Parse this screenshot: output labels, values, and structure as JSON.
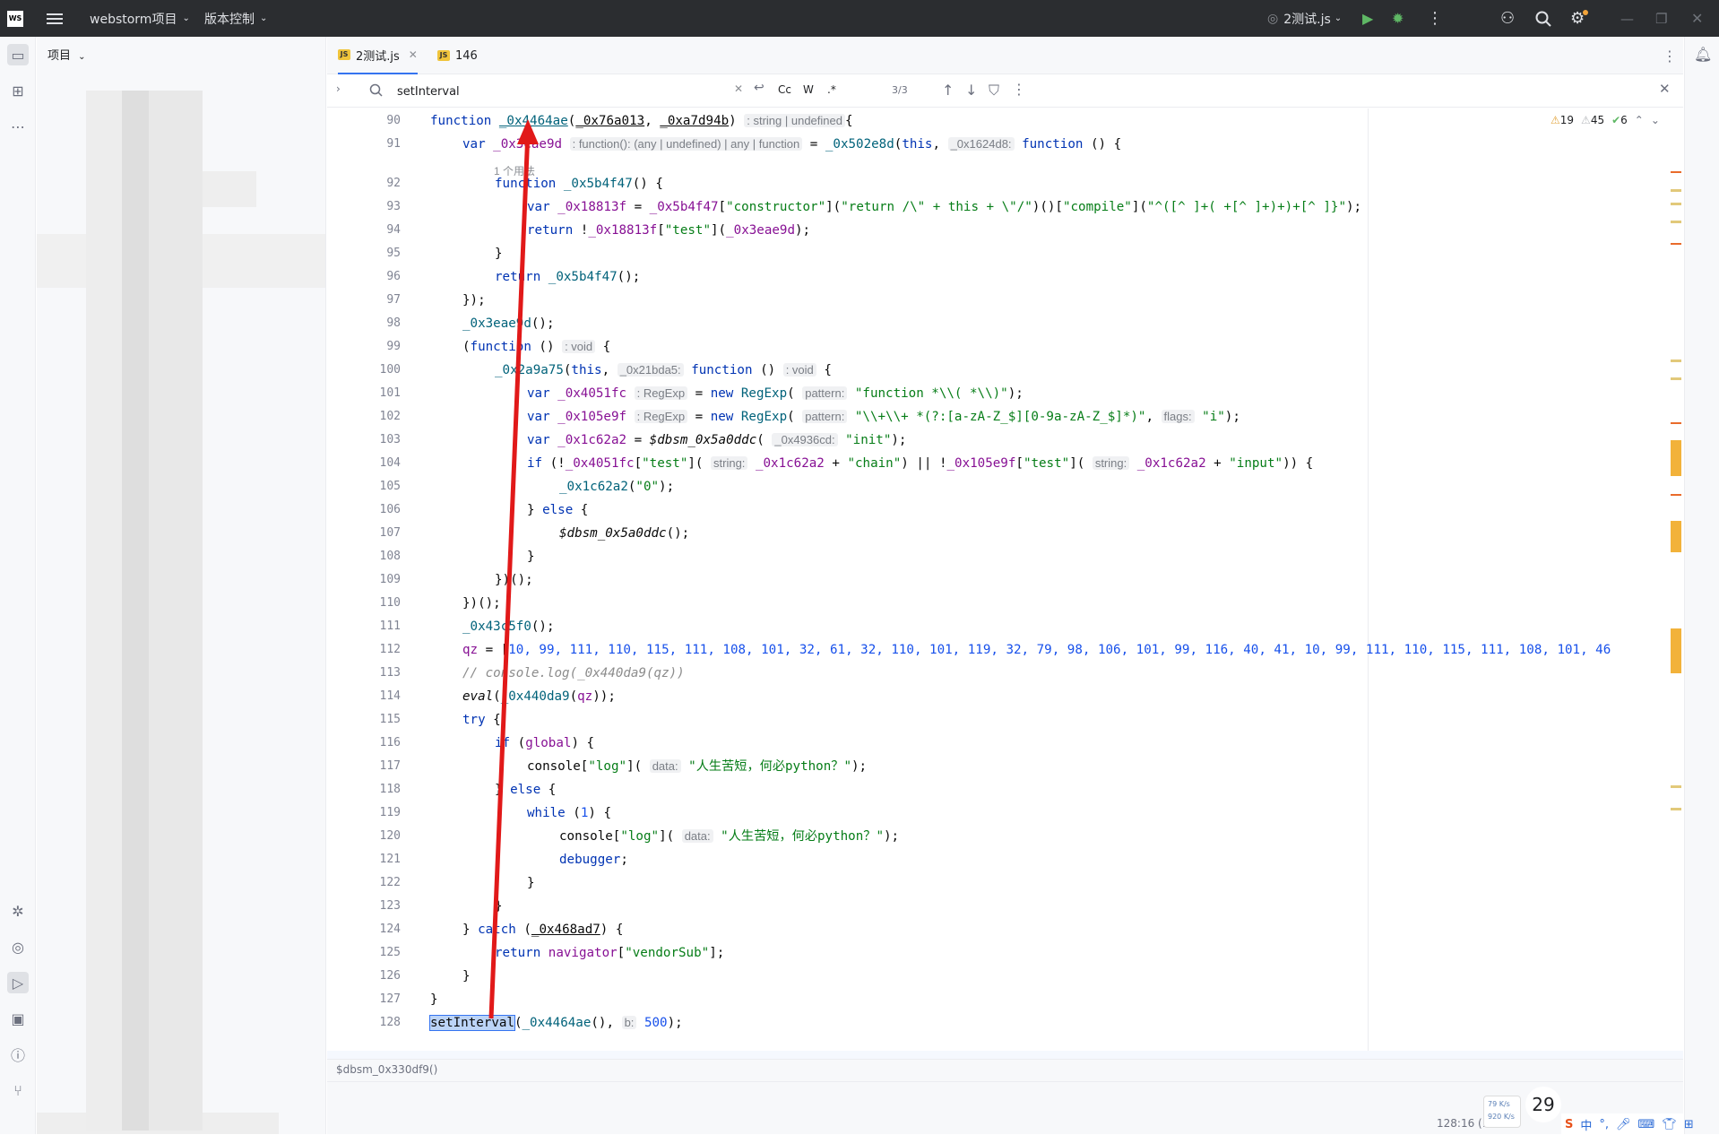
{
  "titlebar": {
    "logo": "WS",
    "project": "webstorm项目",
    "vcs": "版本控制",
    "run_config": "2测试.js"
  },
  "sidebar": {
    "title": "项目"
  },
  "tabs": [
    {
      "label": "2测试.js"
    },
    {
      "label": "146"
    }
  ],
  "find": {
    "query": "setInterval",
    "count": "3/3",
    "opt_case": "Cc",
    "opt_word": "W",
    "opt_regex": ".*"
  },
  "inspections": {
    "warnings1": "19",
    "warnings2": "45",
    "ok": "6"
  },
  "code_lines": [
    {
      "n": "90",
      "indent": 0,
      "html": "<span class='k'>function</span> <span class='f' style='text-decoration:underline'>_0x4464ae</span>(<span style='text-decoration:underline'>_0x76a013</span>, <span style='text-decoration:underline'>_0xa7d94b</span>) <span class='h'>: string | undefined</span>{"
    },
    {
      "n": "91",
      "indent": 1,
      "html": "<span class='k'>var</span> <span class='v'>_0x3eae9d</span> <span class='h'>: function(): (any | undefined) | any | function</span> = <span class='f'>_0x502e8d</span>(<span class='k'>this</span>, <span class='h'>_0x1624d8:</span> <span class='k'>function</span> () {"
    },
    {
      "n": "92",
      "indent": 2,
      "html": "<span class='k'>function</span> <span class='f'>_0x5b4f47</span>() {"
    },
    {
      "n": "93",
      "indent": 3,
      "html": "<span class='k'>var</span> <span class='v'>_0x18813f</span> = <span class='v'>_0x5b4f47</span>[<span class='s'>\"constructor\"</span>](<span class='s'>\"return /\\\" + this + \\\"/\"</span>)()[<span class='s'>\"compile\"</span>](<span class='s'>\"^([^ ]+( +[^ ]+)+)+[^ ]}\"</span>);"
    },
    {
      "n": "94",
      "indent": 3,
      "html": "<span class='k'>return</span> !<span class='v'>_0x18813f</span>[<span class='s'>\"test\"</span>](<span class='v'>_0x3eae9d</span>);"
    },
    {
      "n": "95",
      "indent": 2,
      "html": "}"
    },
    {
      "n": "96",
      "indent": 2,
      "html": "<span class='k'>return</span> <span class='f'>_0x5b4f47</span>();"
    },
    {
      "n": "97",
      "indent": 1,
      "html": "});"
    },
    {
      "n": "98",
      "indent": 1,
      "html": "<span class='f'>_0x3eae9d</span>();"
    },
    {
      "n": "99",
      "indent": 1,
      "html": "(<span class='k'>function</span> () <span class='h'>: void</span> {"
    },
    {
      "n": "100",
      "indent": 2,
      "html": "<span class='f'>_0x2a9a75</span>(<span class='k'>this</span>, <span class='h'>_0x21bda5:</span> <span class='k'>function</span> () <span class='h'>: void</span> {"
    },
    {
      "n": "101",
      "indent": 3,
      "html": "<span class='k'>var</span> <span class='v'>_0x4051fc</span> <span class='h'>: RegExp</span> = <span class='k'>new</span> <span class='f'>RegExp</span>( <span class='h'>pattern:</span> <span class='s'>\"function *\\\\( *\\\\)\"</span>);"
    },
    {
      "n": "102",
      "indent": 3,
      "html": "<span class='k'>var</span> <span class='v'>_0x105e9f</span> <span class='h'>: RegExp</span> = <span class='k'>new</span> <span class='f'>RegExp</span>( <span class='h'>pattern:</span> <span class='s'>\"\\\\+\\\\+ *(?:[a-zA-Z_$][0-9a-zA-Z_$]*)\"</span>, <span class='h'>flags:</span> <span class='s'>\"i\"</span>);"
    },
    {
      "n": "103",
      "indent": 3,
      "html": "<span class='k'>var</span> <span class='v'>_0x1c62a2</span> = <span class='it'>$dbsm_0x5a0ddc</span>( <span class='h'>_0x4936cd:</span> <span class='s'>\"init\"</span>);"
    },
    {
      "n": "104",
      "indent": 3,
      "html": "<span class='k'>if</span> (!<span class='v'>_0x4051fc</span>[<span class='s'>\"test\"</span>]( <span class='h'>string:</span> <span class='v'>_0x1c62a2</span> + <span class='s'>\"chain\"</span>) || !<span class='v'>_0x105e9f</span>[<span class='s'>\"test\"</span>]( <span class='h'>string:</span> <span class='v'>_0x1c62a2</span> + <span class='s'>\"input\"</span>)) {"
    },
    {
      "n": "105",
      "indent": 4,
      "html": "<span class='f'>_0x1c62a2</span>(<span class='s'>\"0\"</span>);"
    },
    {
      "n": "106",
      "indent": 3,
      "html": "} <span class='k'>else</span> {"
    },
    {
      "n": "107",
      "indent": 4,
      "html": "<span class='it'>$dbsm_0x5a0ddc</span>();"
    },
    {
      "n": "108",
      "indent": 3,
      "html": "}"
    },
    {
      "n": "109",
      "indent": 2,
      "html": "})();"
    },
    {
      "n": "110",
      "indent": 1,
      "html": "})();"
    },
    {
      "n": "111",
      "indent": 1,
      "html": "<span class='f'>_0x43c5f0</span>();"
    },
    {
      "n": "112",
      "indent": 1,
      "html": "<span class='v'>qz</span> = [<span class='n'>10, 99, 111, 110, 115, 111, 108, 101, 32, 61, 32, 110, 101, 119, 32, 79, 98, 106, 101, 99, 116, 40, 41, 10, 99, 111, 110, 115, 111, 108, 101, 46</span>"
    },
    {
      "n": "113",
      "indent": 1,
      "html": "<span class='c'>// console.log(_0x440da9(qz))</span>"
    },
    {
      "n": "114",
      "indent": 1,
      "html": "<span class='it'>eval</span>(<span class='f'>_0x440da9</span>(<span class='v'>qz</span>));"
    },
    {
      "n": "115",
      "indent": 1,
      "html": "<span class='k'>try</span> {"
    },
    {
      "n": "116",
      "indent": 2,
      "html": "<span class='k'>if</span> (<span class='v'>global</span>) {"
    },
    {
      "n": "117",
      "indent": 3,
      "html": "console[<span class='s'>\"log\"</span>]( <span class='h'>data:</span> <span class='s'>\"人生苦短，何必python？\"</span>);"
    },
    {
      "n": "118",
      "indent": 2,
      "html": "} <span class='k'>else</span> {"
    },
    {
      "n": "119",
      "indent": 3,
      "html": "<span class='k'>while</span> (<span class='n'>1</span>) {"
    },
    {
      "n": "120",
      "indent": 4,
      "html": "console[<span class='s'>\"log\"</span>]( <span class='h'>data:</span> <span class='s'>\"人生苦短，何必python？\"</span>);"
    },
    {
      "n": "121",
      "indent": 4,
      "html": "<span class='k'>debugger</span>;"
    },
    {
      "n": "122",
      "indent": 3,
      "html": "}"
    },
    {
      "n": "123",
      "indent": 2,
      "html": "}"
    },
    {
      "n": "124",
      "indent": 1,
      "html": "} <span class='k'>catch</span> (<span style='text-decoration:underline'>_0x468ad7</span>) {"
    },
    {
      "n": "125",
      "indent": 2,
      "html": "<span class='k'>return</span> <span class='v'>navigator</span>[<span class='s'>\"vendorSub\"</span>];"
    },
    {
      "n": "126",
      "indent": 1,
      "html": "}"
    },
    {
      "n": "127",
      "indent": 0,
      "html": "}"
    },
    {
      "n": "128",
      "indent": 0,
      "html": "<span style='background:#bcd4f7;outline:1px solid #3574f0'>setInterval</span>(<span class='f'>_0x4464ae</span>(), <span class='h'>b:</span> <span class='n'>500</span>);"
    }
  ],
  "hints": {
    "usages": "1 个用法"
  },
  "status": {
    "breadcrumb": "$dbsm_0x330df9()",
    "position": "128:16 (1",
    "clock": "29",
    "net_up": "79 K/s",
    "net_down": "920 K/s",
    "ime": "中"
  }
}
